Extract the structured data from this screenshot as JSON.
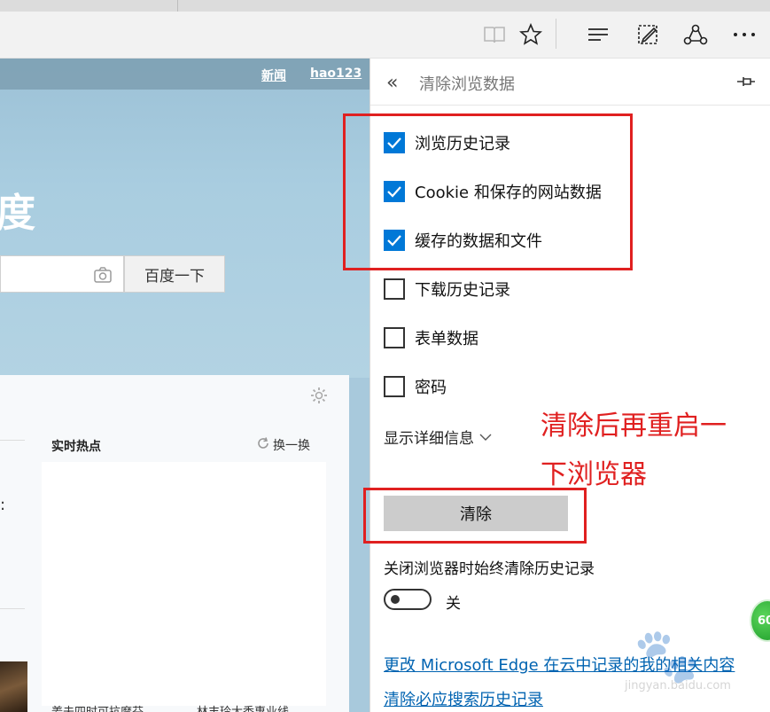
{
  "browser": {
    "toolbar_icons": [
      "reading-view-icon",
      "favorite-star-icon",
      "hub-icon",
      "web-note-icon",
      "share-icon",
      "more-icon"
    ]
  },
  "page": {
    "nav_links": [
      "新闻",
      "hao123"
    ],
    "logo_fragment": "度",
    "search_button": "百度一下",
    "hot_title": "实时热点",
    "refresh_label": "换一换",
    "colon_fragment": ":",
    "bottom_texts": [
      "姜夫四时可抗摩芬",
      "林丰玲大秃惠业线"
    ]
  },
  "panel": {
    "title": "清除浏览数据",
    "options": [
      {
        "label": "浏览历史记录",
        "checked": true
      },
      {
        "label": "Cookie 和保存的网站数据",
        "checked": true
      },
      {
        "label": "缓存的数据和文件",
        "checked": true
      },
      {
        "label": "下载历史记录",
        "checked": false
      },
      {
        "label": "表单数据",
        "checked": false
      },
      {
        "label": "密码",
        "checked": false
      }
    ],
    "show_details": "显示详细信息",
    "clear_button": "清除",
    "always_clear_label": "关闭浏览器时始终清除历史记录",
    "toggle_state": "关",
    "links": [
      "更改 Microsoft Edge 在云中记录的我的相关内容",
      "清除必应搜索历史记录"
    ]
  },
  "annotation": {
    "line1": "清除后再重启一",
    "line2": "下浏览器",
    "color": "#e02020"
  },
  "overlay": {
    "badge_text": "60",
    "watermark_text": "jingyan.baidu.com"
  },
  "colors": {
    "checkbox_accent": "#0078d7",
    "link": "#0063b1",
    "button_bg": "#cccccc"
  }
}
